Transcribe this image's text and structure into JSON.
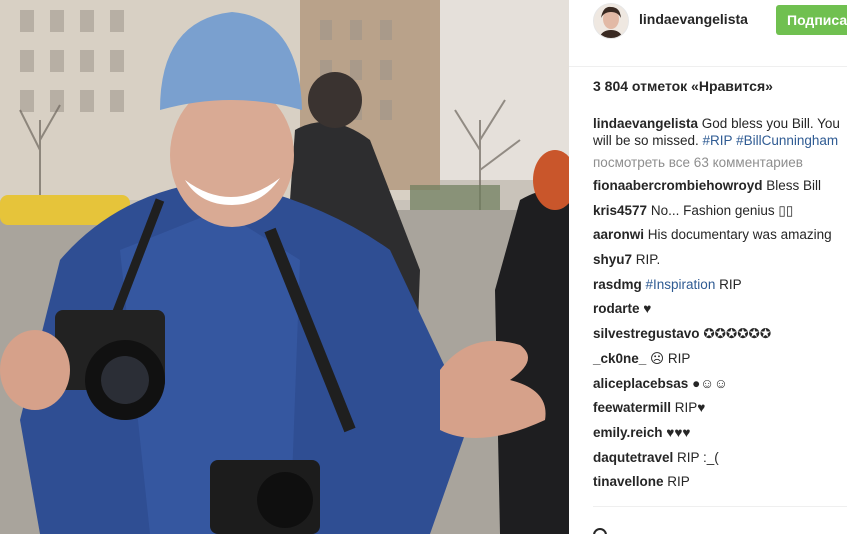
{
  "post": {
    "image_alt_semantic": "street-photo"
  },
  "header": {
    "username": "lindaevangelista",
    "follow_label": "Подписаться"
  },
  "likes_label": "3 804 отметок «Нравится»",
  "caption": {
    "username": "lindaevangelista",
    "text_1": " God bless you Bill. You",
    "text_2": "will be so missed. ",
    "tag_1": "#RIP",
    "tag_2": " #BillCunningham"
  },
  "view_all_comments": "посмотреть все 63 комментариев",
  "comments": [
    {
      "user": "fionaabercrombiehowroyd",
      "text": " Bless Bill"
    },
    {
      "user": "kris4577",
      "text": " No... Fashion genius ▯▯"
    },
    {
      "user": "aaronwi",
      "text": " His documentary was amazing"
    },
    {
      "user": "shyu7",
      "text": " RIP."
    },
    {
      "user": "rasdmg",
      "tag": " #Inspiration",
      "text": " RIP"
    },
    {
      "user": "rodarte",
      "text": " ♥"
    },
    {
      "user": "silvestregustavo",
      "text": " ✪✪✪✪✪✪"
    },
    {
      "user": "_ck0ne_",
      "text": " ☹ RIP"
    },
    {
      "user": "aliceplacebsas",
      "text": " ●☺☺"
    },
    {
      "user": "feewatermill",
      "text": " RIP♥"
    },
    {
      "user": "emily.reich",
      "text": " ♥♥♥"
    },
    {
      "user": "daqutetravel",
      "text": " RIP :_("
    },
    {
      "user": "tinavellone",
      "text": " RIP"
    }
  ],
  "colors": {
    "follow_bg": "#70c050",
    "hashtag": "#2f5b93",
    "muted": "#8e8e8e"
  }
}
